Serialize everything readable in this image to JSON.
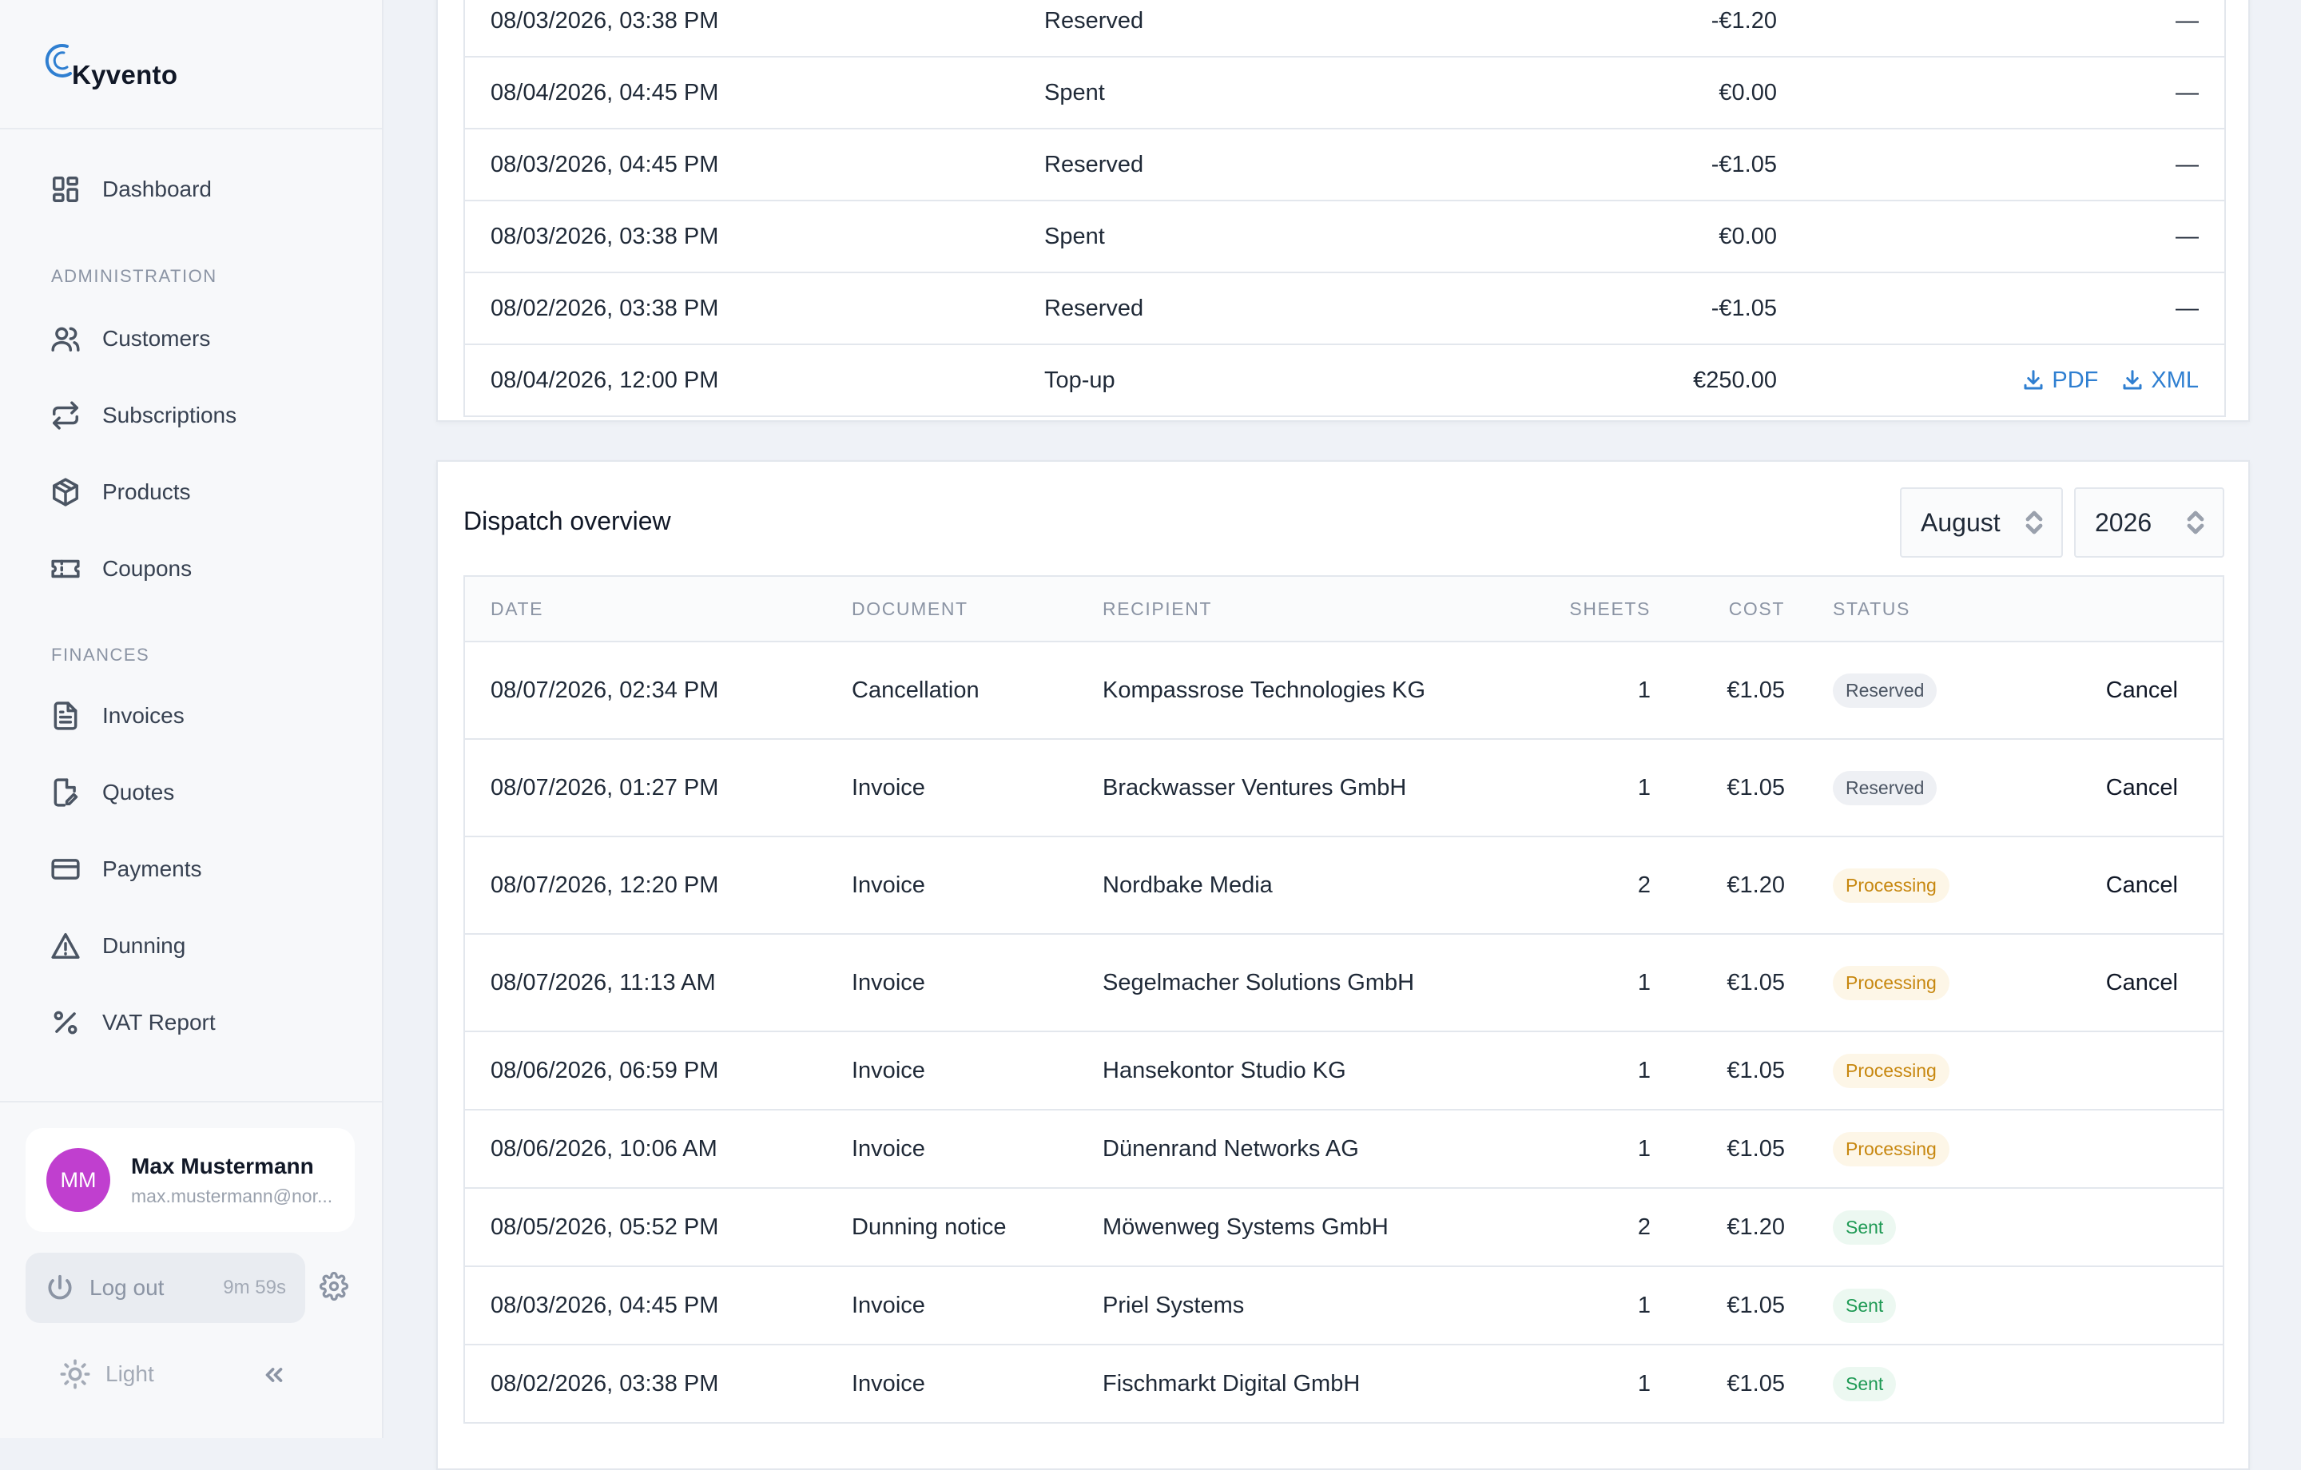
{
  "app": {
    "name": "Kyvento",
    "brand_color": "#2f7fd1"
  },
  "sidebar": {
    "top_item": {
      "label": "Dashboard",
      "icon": "dashboard-icon"
    },
    "sections": [
      {
        "label": "ADMINISTRATION",
        "items": [
          {
            "label": "Customers",
            "icon": "users-icon"
          },
          {
            "label": "Subscriptions",
            "icon": "repeat-icon"
          },
          {
            "label": "Products",
            "icon": "box-icon"
          },
          {
            "label": "Coupons",
            "icon": "ticket-icon"
          }
        ]
      },
      {
        "label": "FINANCES",
        "items": [
          {
            "label": "Invoices",
            "icon": "document-icon"
          },
          {
            "label": "Quotes",
            "icon": "edit-document-icon"
          },
          {
            "label": "Payments",
            "icon": "credit-card-icon"
          },
          {
            "label": "Dunning",
            "icon": "warning-icon"
          },
          {
            "label": "VAT Report",
            "icon": "percent-icon"
          }
        ]
      }
    ],
    "user": {
      "initials": "MM",
      "name": "Max Mustermann",
      "email": "max.mustermann@nor...",
      "avatar_color": "#c03fcf"
    },
    "logout": {
      "label": "Log out",
      "timer": "9m 59s"
    },
    "theme": {
      "label": "Light"
    }
  },
  "transactions": {
    "rows": [
      {
        "date": "08/03/2026, 03:38 PM",
        "type": "Reserved",
        "amount": "-€1.20",
        "action": "—"
      },
      {
        "date": "08/04/2026, 04:45 PM",
        "type": "Spent",
        "amount": "€0.00",
        "action": "—"
      },
      {
        "date": "08/03/2026, 04:45 PM",
        "type": "Reserved",
        "amount": "-€1.05",
        "action": "—"
      },
      {
        "date": "08/03/2026, 03:38 PM",
        "type": "Spent",
        "amount": "€0.00",
        "action": "—"
      },
      {
        "date": "08/02/2026, 03:38 PM",
        "type": "Reserved",
        "amount": "-€1.05",
        "action": "—"
      },
      {
        "date": "08/04/2026, 12:00 PM",
        "type": "Top-up",
        "amount": "€250.00",
        "pdf": "PDF",
        "xml": "XML"
      }
    ]
  },
  "dispatch": {
    "title": "Dispatch overview",
    "month": "August",
    "year": "2026",
    "columns": {
      "date": "DATE",
      "document": "DOCUMENT",
      "recipient": "RECIPIENT",
      "sheets": "SHEETS",
      "cost": "COST",
      "status": "STATUS"
    },
    "status_colors": {
      "Reserved": {
        "bg": "#eef0f4",
        "fg": "#4b5563"
      },
      "Processing": {
        "bg": "#fdf6e7",
        "fg": "#c7870f"
      },
      "Sent": {
        "bg": "#ecf8f1",
        "fg": "#1f9a55"
      }
    },
    "rows": [
      {
        "date": "08/07/2026, 02:34 PM",
        "document": "Cancellation",
        "recipient": "Kompassrose Technologies KG",
        "sheets": "1",
        "cost": "€1.05",
        "status": "Reserved",
        "action": "Cancel"
      },
      {
        "date": "08/07/2026, 01:27 PM",
        "document": "Invoice",
        "recipient": "Brackwasser Ventures GmbH",
        "sheets": "1",
        "cost": "€1.05",
        "status": "Reserved",
        "action": "Cancel"
      },
      {
        "date": "08/07/2026, 12:20 PM",
        "document": "Invoice",
        "recipient": "Nordbake Media",
        "sheets": "2",
        "cost": "€1.20",
        "status": "Processing",
        "action": "Cancel"
      },
      {
        "date": "08/07/2026, 11:13 AM",
        "document": "Invoice",
        "recipient": "Segelmacher Solutions GmbH",
        "sheets": "1",
        "cost": "€1.05",
        "status": "Processing",
        "action": "Cancel"
      },
      {
        "date": "08/06/2026, 06:59 PM",
        "document": "Invoice",
        "recipient": "Hansekontor Studio KG",
        "sheets": "1",
        "cost": "€1.05",
        "status": "Processing",
        "action": ""
      },
      {
        "date": "08/06/2026, 10:06 AM",
        "document": "Invoice",
        "recipient": "Dünenrand Networks AG",
        "sheets": "1",
        "cost": "€1.05",
        "status": "Processing",
        "action": ""
      },
      {
        "date": "08/05/2026, 05:52 PM",
        "document": "Dunning notice",
        "recipient": "Möwenweg Systems GmbH",
        "sheets": "2",
        "cost": "€1.20",
        "status": "Sent",
        "action": ""
      },
      {
        "date": "08/03/2026, 04:45 PM",
        "document": "Invoice",
        "recipient": "Priel Systems",
        "sheets": "1",
        "cost": "€1.05",
        "status": "Sent",
        "action": ""
      },
      {
        "date": "08/02/2026, 03:38 PM",
        "document": "Invoice",
        "recipient": "Fischmarkt Digital GmbH",
        "sheets": "1",
        "cost": "€1.05",
        "status": "Sent",
        "action": ""
      }
    ]
  }
}
